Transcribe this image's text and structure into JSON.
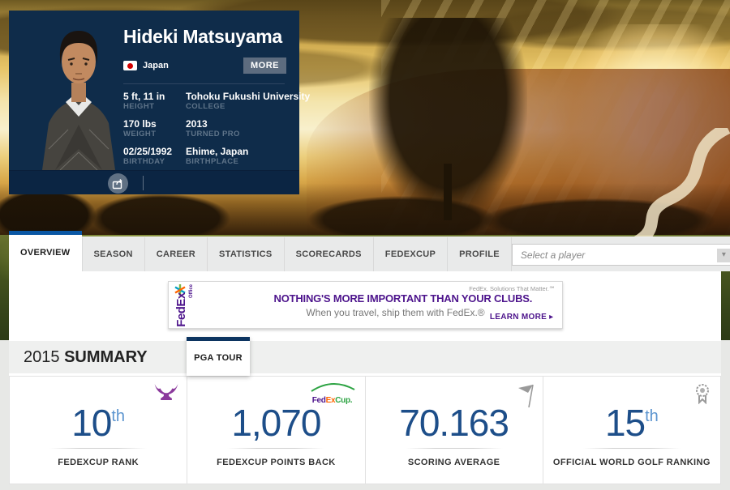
{
  "player_card": {
    "name": "Hideki Matsuyama",
    "country": "Japan",
    "more_label": "MORE",
    "stats": [
      {
        "value": "5 ft, 11 in",
        "label": "HEIGHT"
      },
      {
        "value": "Tohoku Fukushi University",
        "label": "COLLEGE"
      },
      {
        "value": "170 lbs",
        "label": "WEIGHT"
      },
      {
        "value": "2013",
        "label": "TURNED PRO"
      },
      {
        "value": "02/25/1992",
        "label": "BIRTHDAY"
      },
      {
        "value": "Ehime, Japan",
        "label": "BIRTHPLACE"
      }
    ]
  },
  "nav": {
    "tabs": [
      {
        "label": "OVERVIEW",
        "active": true
      },
      {
        "label": "SEASON"
      },
      {
        "label": "CAREER"
      },
      {
        "label": "STATISTICS"
      },
      {
        "label": "SCORECARDS"
      },
      {
        "label": "FEDEXCUP"
      },
      {
        "label": "PROFILE"
      }
    ],
    "player_select_placeholder": "Select a player",
    "select_arrow": "▾"
  },
  "ad": {
    "logo_text": "FedEx",
    "logo_sub": "Office",
    "tagline": "FedEx. Solutions That Matter.℠",
    "headline": "NOTHING'S MORE IMPORTANT THAN YOUR CLUBS.",
    "subline": "When you travel, ship them with FedEx.®",
    "cta": "LEARN MORE ▸"
  },
  "summary": {
    "year": "2015",
    "title": "SUMMARY",
    "tour_tab": "PGA TOUR",
    "fedexcup_logo": {
      "fed": "Fed",
      "ex": "Ex",
      "cup": "Cup."
    },
    "cards": [
      {
        "value": "10",
        "suffix": "th",
        "label": "FEDEXCUP RANK"
      },
      {
        "value": "1,070",
        "suffix": "",
        "label": "FEDEXCUP POINTS BACK"
      },
      {
        "value": "70.163",
        "suffix": "",
        "label": "SCORING AVERAGE"
      },
      {
        "value": "15",
        "suffix": "th",
        "label": "OFFICIAL WORLD GOLF RANKING"
      }
    ]
  },
  "colors": {
    "card_navy": "#0f2c4a",
    "active_tab_blue": "#0a57a4",
    "tour_tab_navy": "#0c3460",
    "stat_number_blue": "#1d4e89",
    "fedex_purple": "#4d148c",
    "fedex_orange": "#ff6600",
    "fedexcup_green": "#2da343",
    "trophy_purple": "#8b3a9c"
  }
}
